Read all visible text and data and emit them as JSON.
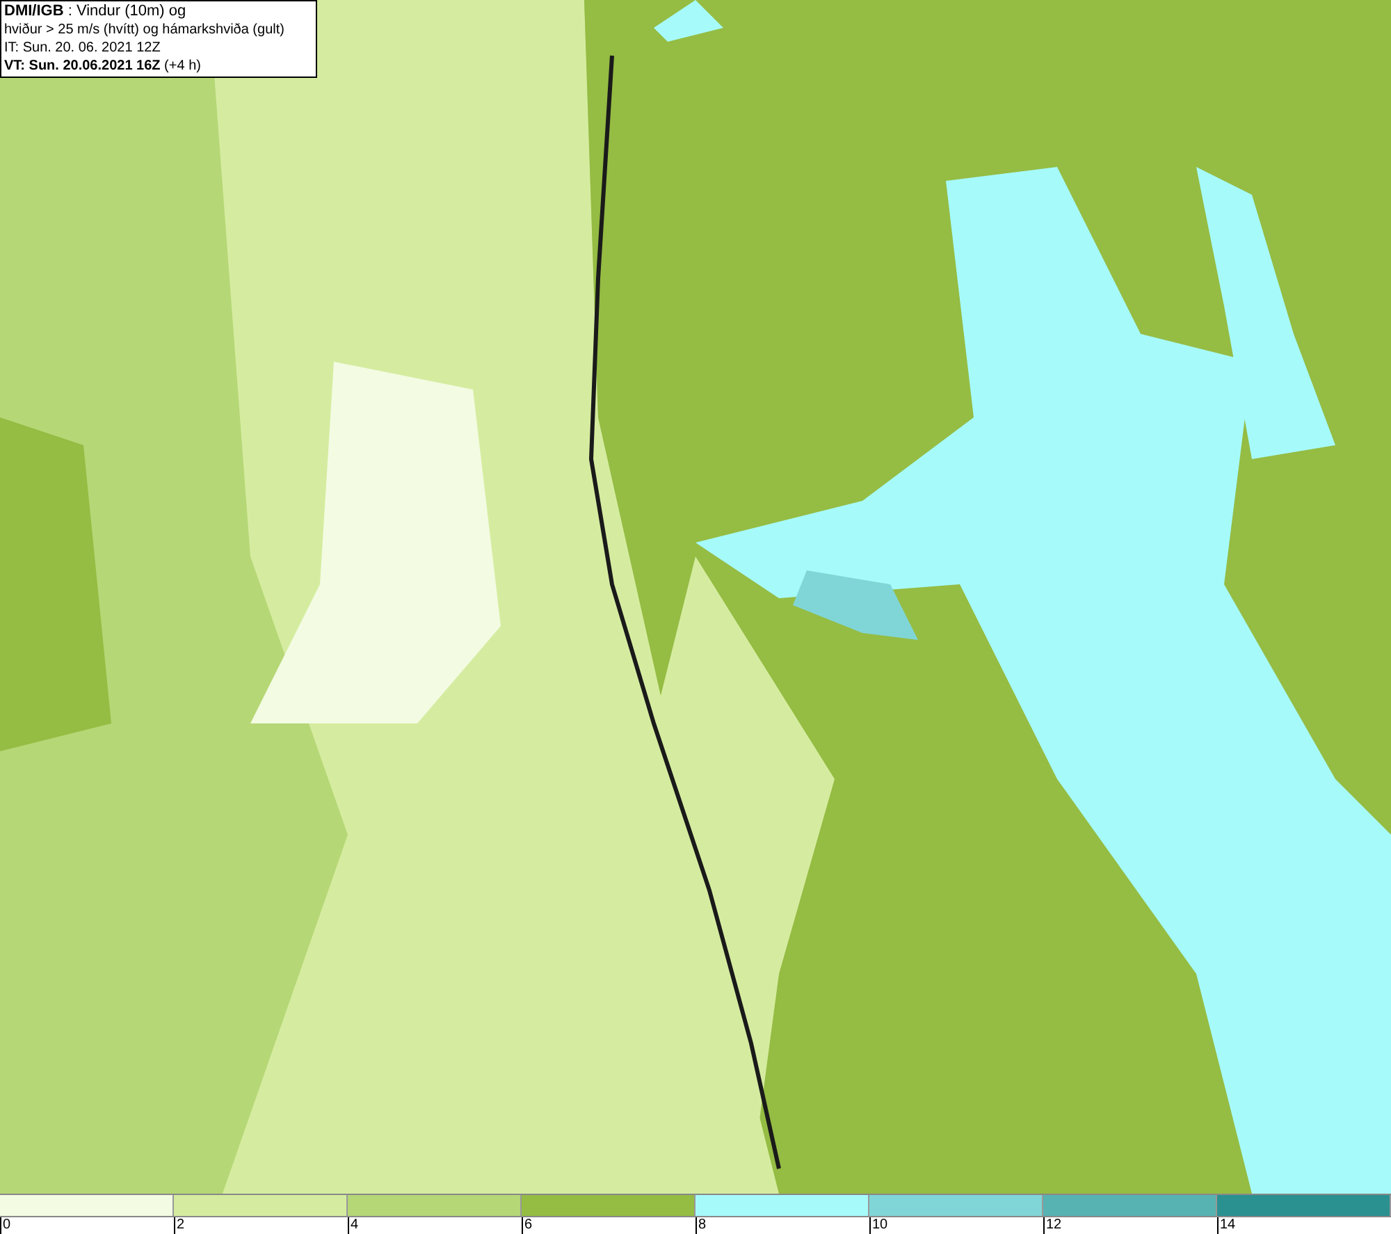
{
  "header": {
    "lines": [
      "**DMI/IGB** : Vindur (10m) og",
      "hviður > 25 m/s (hvítt) og hámarkshviða (gult)",
      "IT: Sun. 20. 06. 2021 12Z",
      "**VT: Sun. 20.06.2021 16Z** (+4 h)"
    ]
  },
  "legend": {
    "items": [
      {
        "label": "0",
        "color": "#f3fbe2"
      },
      {
        "label": "2",
        "color": "#d5eca0"
      },
      {
        "label": "4",
        "color": "#b6d776"
      },
      {
        "label": "6",
        "color": "#95bc43"
      },
      {
        "label": "8",
        "color": "#a6fafa"
      },
      {
        "label": "10",
        "color": "#80d6d6"
      },
      {
        "label": "12",
        "color": "#57b2b2"
      },
      {
        "label": "14",
        "color": "#2a9090"
      }
    ]
  }
}
